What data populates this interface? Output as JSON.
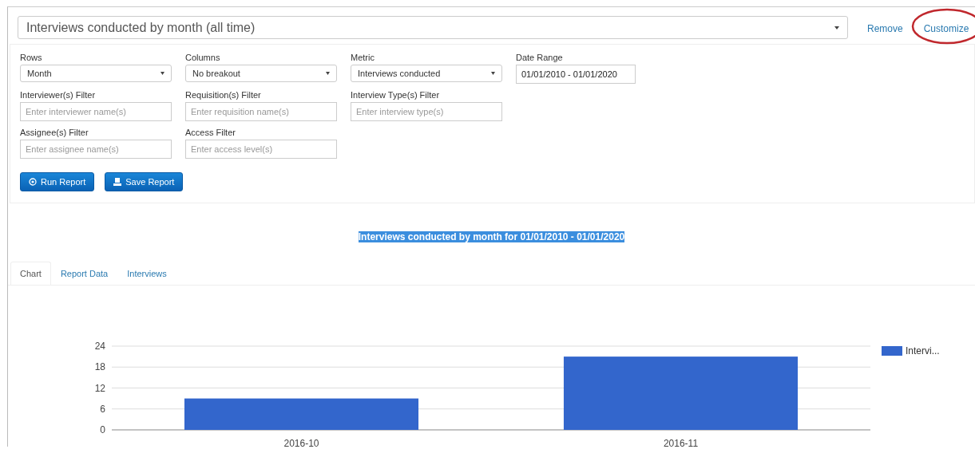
{
  "report_select": {
    "value": "Interviews conducted by month (all time)"
  },
  "header_links": [
    {
      "label": "Remove",
      "circled": false
    },
    {
      "label": "Customize",
      "circled": true
    }
  ],
  "filters": [
    {
      "label": "Rows",
      "kind": "select",
      "value": "Month"
    },
    {
      "label": "Columns",
      "kind": "select",
      "value": "No breakout"
    },
    {
      "label": "Metric",
      "kind": "select",
      "value": "Interviews conducted"
    },
    {
      "label": "Date Range",
      "kind": "input",
      "value": "01/01/2010 - 01/01/2020"
    },
    {
      "label": "Interviewer(s) Filter",
      "kind": "input",
      "placeholder": "Enter interviewer name(s)"
    },
    {
      "label": "Requisition(s) Filter",
      "kind": "input",
      "placeholder": "Enter requisition name(s)"
    },
    {
      "label": "Interview Type(s) Filter",
      "kind": "input",
      "placeholder": "Enter interview type(s)"
    },
    {
      "kind": "break"
    },
    {
      "label": "Assignee(s) Filter",
      "kind": "input",
      "placeholder": "Enter assignee name(s)"
    },
    {
      "label": "Access Filter",
      "kind": "input",
      "placeholder": "Enter access level(s)"
    }
  ],
  "buttons": [
    {
      "label": "Run Report",
      "kind": "run"
    },
    {
      "label": "Save Report",
      "kind": "save"
    }
  ],
  "report_title": "Interviews conducted by month for 01/01/2010 - 01/01/2020",
  "tabs": [
    {
      "label": "Chart",
      "selected": true
    },
    {
      "label": "Report Data",
      "selected": false
    },
    {
      "label": "Interviews",
      "selected": false
    }
  ],
  "chart_data": {
    "type": "bar",
    "categories": [
      "2016-10",
      "2016-11"
    ],
    "series": [
      {
        "name": "Intervi...",
        "color": "#3366cc",
        "values": [
          9,
          21
        ]
      }
    ],
    "ylim": [
      0,
      24
    ],
    "yticks": [
      0,
      6,
      12,
      18,
      24
    ],
    "grid": true
  }
}
